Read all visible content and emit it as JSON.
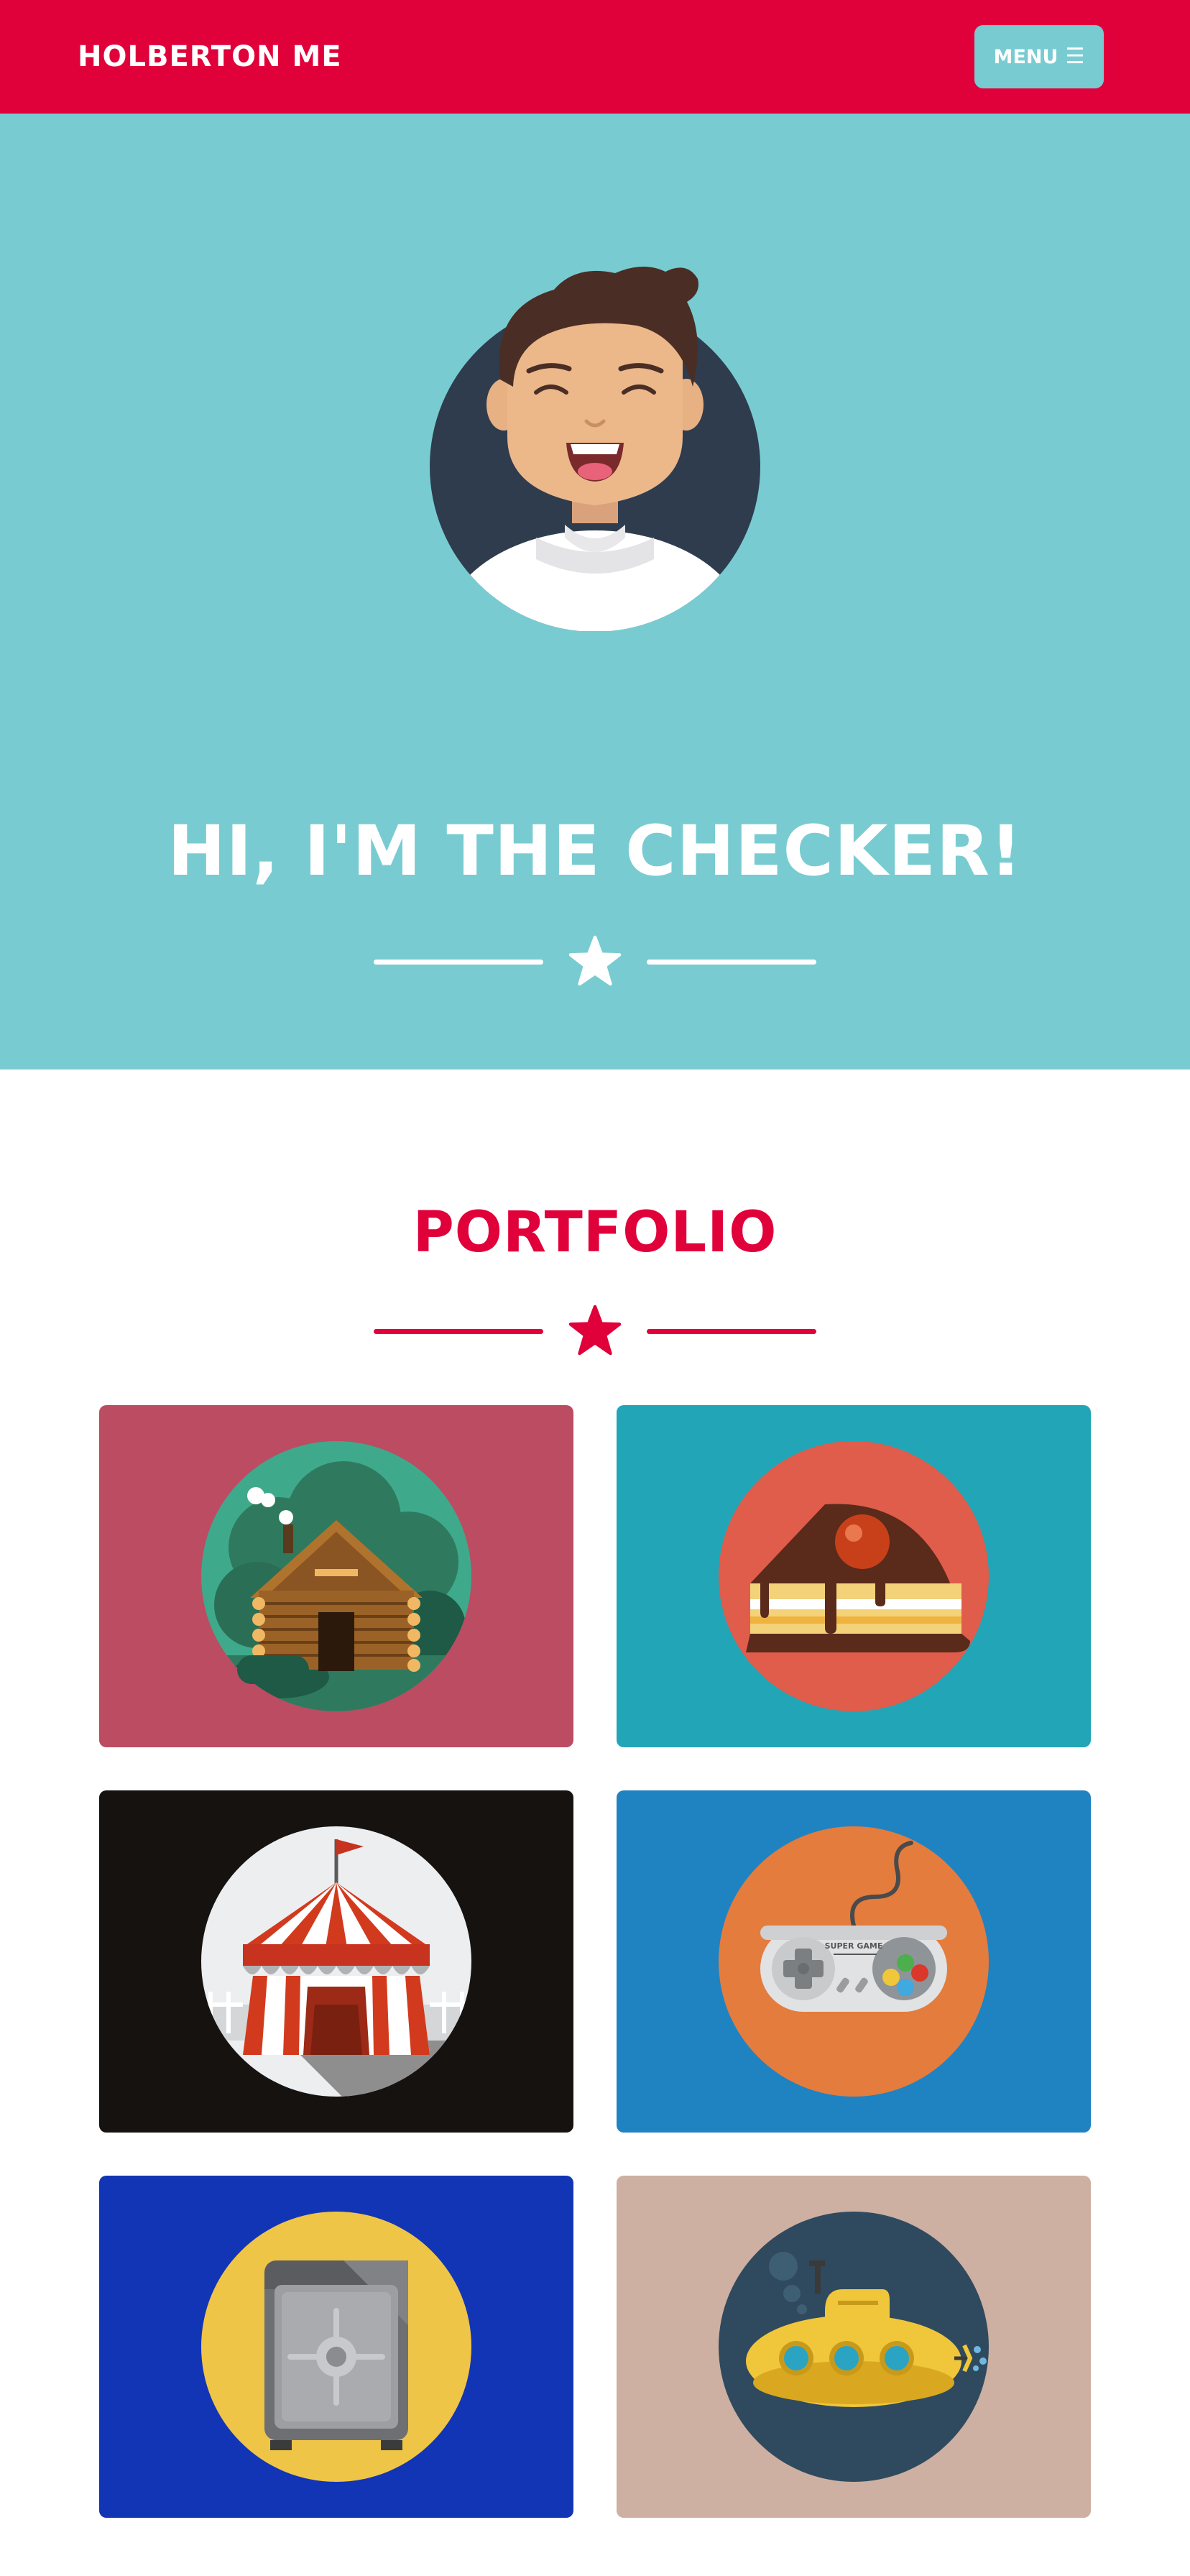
{
  "navbar": {
    "brand": "HOLBERTON ME",
    "menu_label": "MENU",
    "menu_icon": "hamburger-icon",
    "bg_color": "#e0003a",
    "menu_bg_color": "#78ccd1"
  },
  "hero": {
    "title": "HI, I'M THE CHECKER!",
    "bg_color": "#78ccd1",
    "avatar": "smiling-man-avatar",
    "divider_icon": "star-icon"
  },
  "portfolio": {
    "title": "PORTFOLIO",
    "accent_color": "#e0003a",
    "divider_icon": "star-icon",
    "items": [
      {
        "icon": "log-cabin-icon",
        "bg_color": "#bb4c62",
        "circle_color": "#3fa98c"
      },
      {
        "icon": "cake-slice-icon",
        "bg_color": "#22a5b7",
        "circle_color": "#e05c4b"
      },
      {
        "icon": "circus-tent-icon",
        "bg_color": "#161210",
        "circle_color": "#eceef0"
      },
      {
        "icon": "game-controller-icon",
        "bg_color": "#1f83c2",
        "circle_color": "#e47c3e"
      },
      {
        "icon": "safe-icon",
        "bg_color": "#1235b5",
        "circle_color": "#efc548"
      },
      {
        "icon": "submarine-icon",
        "bg_color": "#cdb0a2",
        "circle_color": "#2f4a5e"
      }
    ]
  },
  "controller_text": "SUPER GAME"
}
